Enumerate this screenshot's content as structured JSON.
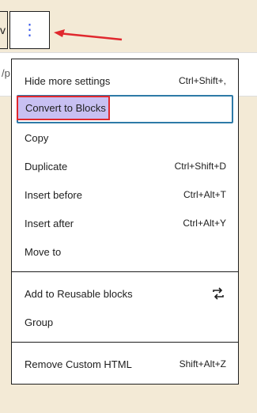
{
  "toolbar": {
    "partial_label": "v",
    "more_icon": "⋮"
  },
  "path_preview": "/p",
  "menu": {
    "group1": [
      {
        "label": "Hide more settings",
        "shortcut": "Ctrl+Shift+,"
      },
      {
        "label": "Convert to Blocks",
        "shortcut": ""
      },
      {
        "label": "Copy",
        "shortcut": ""
      },
      {
        "label": "Duplicate",
        "shortcut": "Ctrl+Shift+D"
      },
      {
        "label": "Insert before",
        "shortcut": "Ctrl+Alt+T"
      },
      {
        "label": "Insert after",
        "shortcut": "Ctrl+Alt+Y"
      },
      {
        "label": "Move to",
        "shortcut": ""
      }
    ],
    "group2": [
      {
        "label": "Add to Reusable blocks",
        "icon": "reusable-block-icon"
      },
      {
        "label": "Group",
        "shortcut": ""
      }
    ],
    "group3": [
      {
        "label": "Remove Custom HTML",
        "shortcut": "Shift+Alt+Z"
      }
    ]
  },
  "colors": {
    "highlight_fill": "#c8c0f2",
    "highlight_border": "#e0282e",
    "arrow": "#e0282e",
    "focus_ring": "#2e7aa7",
    "icon_blue": "#3858e9"
  }
}
